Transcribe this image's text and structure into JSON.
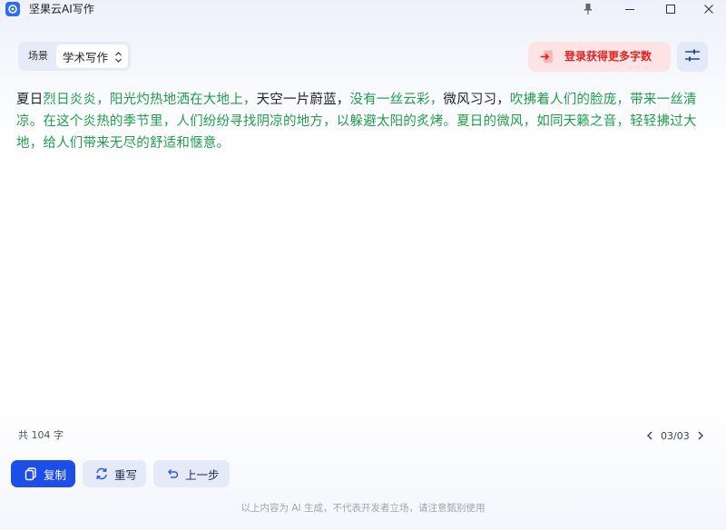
{
  "window": {
    "title": "坚果云AI写作",
    "controls": [
      "pin-icon",
      "minimize-icon",
      "maximize-icon",
      "close-icon"
    ]
  },
  "toolbar": {
    "scene_label": "场景",
    "scene_value": "学术写作",
    "login_label": "登录获得更多字数"
  },
  "content": {
    "segments": [
      {
        "text": "夏日",
        "tone": "dark"
      },
      {
        "text": "烈日炎炎，阳光灼热地洒在大地上，",
        "tone": "green"
      },
      {
        "text": "天空一片蔚蓝，",
        "tone": "dark"
      },
      {
        "text": "没有一丝云彩，",
        "tone": "green"
      },
      {
        "text": "微风习习，",
        "tone": "dark"
      },
      {
        "text": "吹拂着人们的脸庞，带来一丝清凉。在这个炎热的季节里，人们纷纷寻找阴凉的地方，以躲避太阳的炙烤。夏日的微风，如同天籁之音，轻轻拂过大地，给人们带来无尽的舒适和惬意。",
        "tone": "green"
      }
    ]
  },
  "footer": {
    "word_count": "共 104 字",
    "page_indicator": "03/03",
    "copy_label": "复制",
    "rewrite_label": "重写",
    "undo_label": "上一步",
    "disclaimer": "以上内容为 AI 生成，不代表开发者立场，请注意甄别使用"
  },
  "colors": {
    "accent": "#1d4fe8",
    "generated_text": "#1f9d4c",
    "login_text": "#e02424",
    "login_bg": "#fde4e4"
  }
}
